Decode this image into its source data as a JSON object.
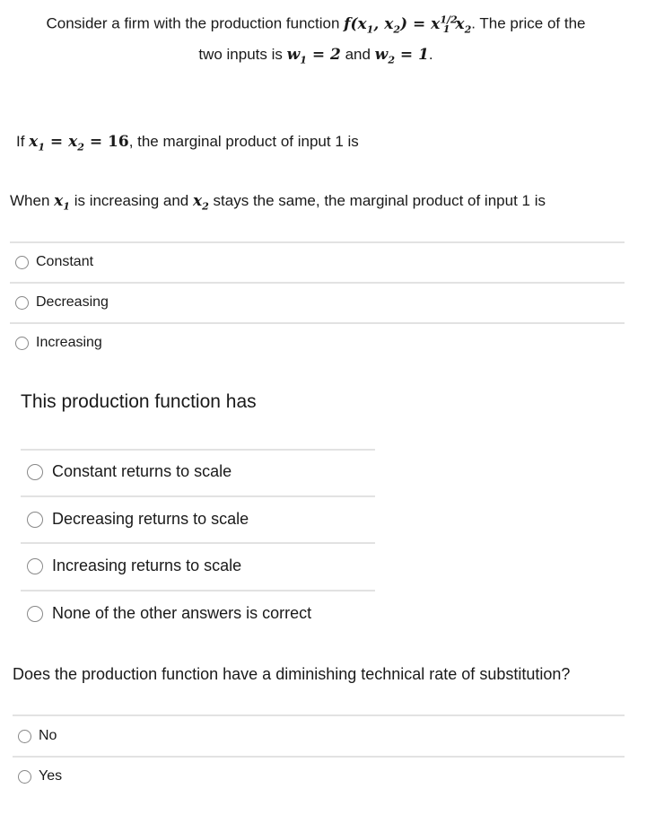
{
  "intro": {
    "text_a": "Consider a firm with the production function ",
    "formula": "f(x1, x2) = x1^(1/2) x2",
    "f": "f",
    "x": "x",
    "s1": "1",
    "s2": "2",
    "exp": "1/2",
    "text_b": ". The price of the",
    "text_c": "two inputs is ",
    "w": "w",
    "w1_val": "= 2",
    "and": " and ",
    "w2_val": "= 1",
    "period": "."
  },
  "question1": {
    "prefix": "If ",
    "eq": "= ",
    "eq2": " = ",
    "value": "16",
    "suffix": ", the marginal product of input 1 is"
  },
  "question2": {
    "prefix": "When ",
    "mid": " is increasing and ",
    "suffix": " stays the same, the marginal product of input 1 is",
    "options": [
      "Constant",
      "Decreasing",
      "Increasing"
    ]
  },
  "question3": {
    "text": "This production function has",
    "options": [
      "Constant returns to scale",
      "Decreasing returns to scale",
      "Increasing returns to scale",
      "None of the other answers is correct"
    ]
  },
  "question4": {
    "text": "Does the production function have a diminishing technical rate of substitution?",
    "options": [
      "No",
      "Yes"
    ]
  }
}
